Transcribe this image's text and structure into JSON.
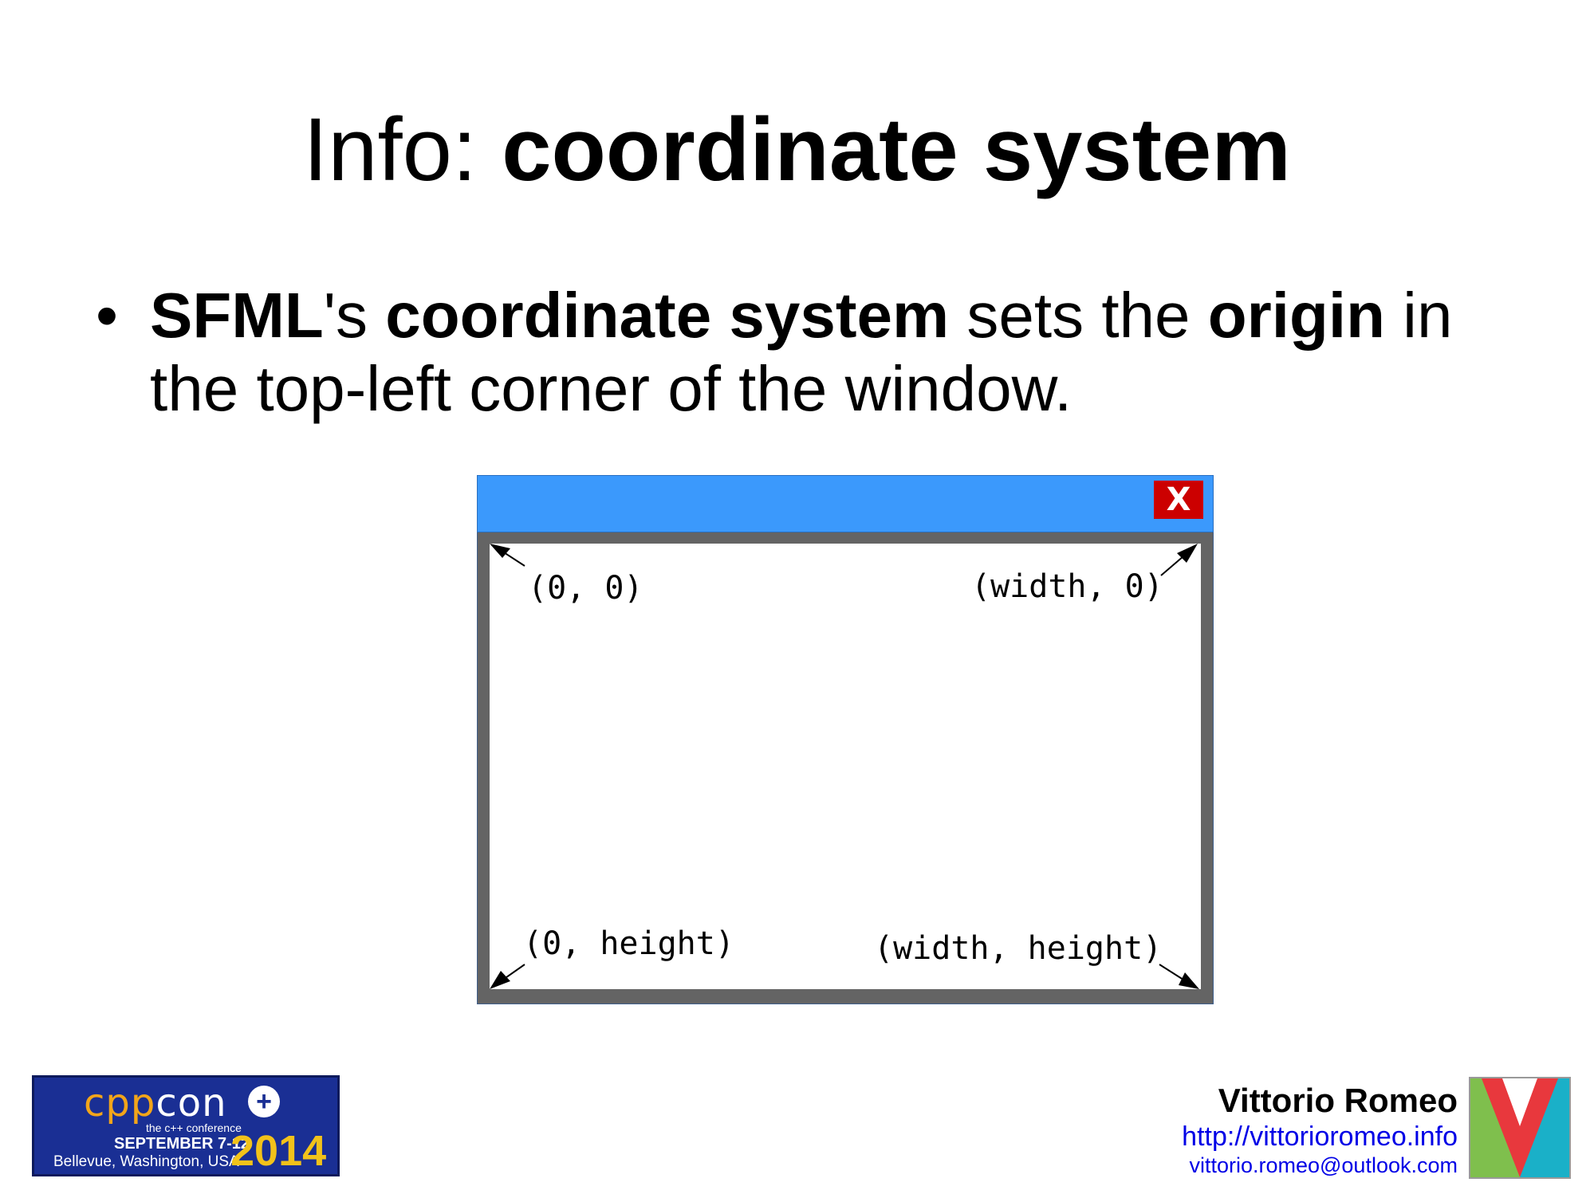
{
  "slide": {
    "title_prefix": "Info:",
    "title_bold": "coordinate system"
  },
  "bullet": {
    "marker": "•",
    "sfml": "SFML",
    "possessive": "'s ",
    "coord_system": "coordinate system",
    "sets_the": " sets the ",
    "origin": "origin",
    "rest": " in the top-left corner of the window."
  },
  "diagram": {
    "close_label": "X",
    "top_left": "(0, 0)",
    "top_right": "(width, 0)",
    "bottom_left": "(0, height)",
    "bottom_right": "(width, height)",
    "colors": {
      "titlebar": "#3b99fc",
      "frame": "#646464",
      "close": "#cc0000"
    }
  },
  "conference": {
    "cpp": "cpp",
    "con": "con",
    "subtitle": "the c++ conference",
    "dates": "SEPTEMBER 7-12",
    "location": "Bellevue, Washington, USA",
    "year": "2014"
  },
  "author": {
    "name": "Vittorio Romeo",
    "url": "http://vittorioromeo.info",
    "email": "vittorio.romeo@outlook.com"
  }
}
